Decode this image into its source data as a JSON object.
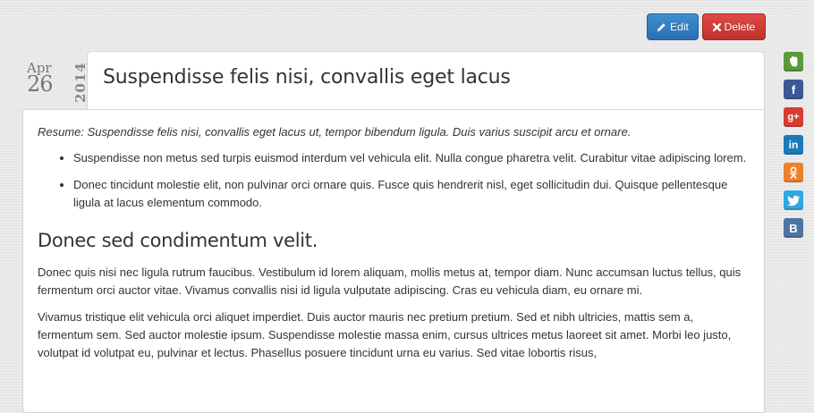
{
  "toolbar": {
    "edit_label": "Edit",
    "delete_label": "Delete",
    "edit_icon": "pencil-icon",
    "delete_icon": "close-icon",
    "colors": {
      "edit": "#2f7bc0",
      "delete": "#d0382f"
    }
  },
  "post": {
    "date": {
      "month": "Apr",
      "day": "26",
      "year": "2014"
    },
    "title": "Suspendisse felis nisi, convallis eget lacus",
    "resume": "Resume: Suspendisse felis nisi, convallis eget lacus ut, tempor bibendum ligula. Duis varius suscipit arcu et ornare.",
    "bullets": [
      "Suspendisse non metus sed turpis euismod interdum vel vehicula elit. Nulla congue pharetra velit. Curabitur vitae adipiscing lorem.",
      "Donec tincidunt molestie elit, non pulvinar orci ornare quis. Fusce quis hendrerit nisl, eget sollicitudin dui. Quisque pellentesque ligula at lacus elementum commodo."
    ],
    "heading": "Donec sed condimentum velit.",
    "paragraphs": [
      "Donec quis nisi nec ligula rutrum faucibus. Vestibulum id lorem aliquam, mollis metus at, tempor diam. Nunc accumsan luctus tellus, quis fermentum orci auctor vitae. Vivamus convallis nisi id ligula vulputate adipiscing. Cras eu vehicula diam, eu ornare mi.",
      "Vivamus tristique elit vehicula orci aliquet imperdiet. Duis auctor mauris nec pretium pretium. Sed et nibh ultricies, mattis sem a, fermentum sem. Sed auctor molestie ipsum. Suspendisse molestie massa enim, cursus ultrices metus laoreet sit amet. Morbi leo justo, volutpat id volutpat eu, pulvinar et lectus. Phasellus posuere tincidunt urna eu varius. Sed vitae lobortis risus,"
    ]
  },
  "share": [
    {
      "icon": "evernote-icon",
      "glyph": "",
      "color": "#5a9a3a"
    },
    {
      "icon": "facebook-icon",
      "glyph": "f",
      "color": "#3b5998"
    },
    {
      "icon": "google-plus-icon",
      "glyph": "g+",
      "color": "#d73d32"
    },
    {
      "icon": "linkedin-icon",
      "glyph": "in",
      "color": "#1a7bb9"
    },
    {
      "icon": "odnoklassniki-icon",
      "glyph": "",
      "color": "#ed812b"
    },
    {
      "icon": "twitter-icon",
      "glyph": "",
      "color": "#2fa8e0"
    },
    {
      "icon": "vkontakte-icon",
      "glyph": "B",
      "color": "#4c75a3"
    }
  ]
}
